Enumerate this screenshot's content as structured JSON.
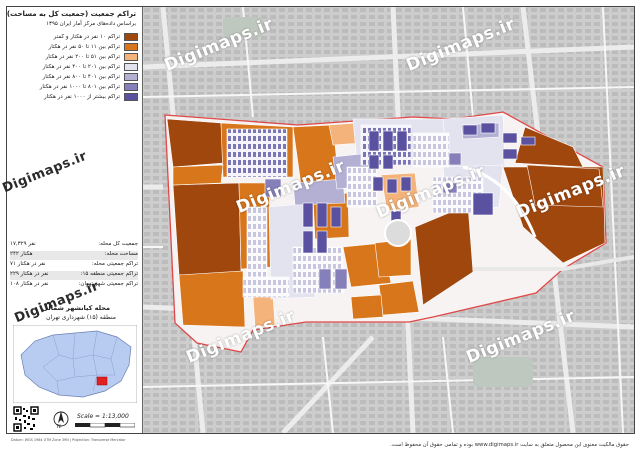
{
  "legend": {
    "title": "تراکم جمعیت (جمعیت کل به مساحت)",
    "subtitle": "براساس داده‌های مرکز آمار ایران ۱۳۹۵",
    "classes": [
      {
        "label": "تراکم ۱۰ نفر در هکتار و کمتر",
        "color": "#a0470e"
      },
      {
        "label": "تراکم بین ۱۱ تا ۵۰ نفر در هکتار",
        "color": "#d8761c"
      },
      {
        "label": "تراکم بین ۵۱ تا ۲۰۰ نفر در هکتار",
        "color": "#f3b37a"
      },
      {
        "label": "تراکم بین ۲۰۱ تا ۴۰۰ نفر در هکتار",
        "color": "#e3e2ef"
      },
      {
        "label": "تراکم بین ۴۰۱ تا ۸۰۰ نفر در هکتار",
        "color": "#b3b0d4"
      },
      {
        "label": "تراکم بین ۸۰۱ تا ۱۰۰۰ نفر در هکتار",
        "color": "#8580ba"
      },
      {
        "label": "تراکم بیشتر از ۱۰۰۰ نفر در هکتار",
        "color": "#5a52a1"
      }
    ]
  },
  "stats": [
    {
      "key": "جمعیت کل محله:",
      "value": "۱۷,۳۲۹ نفر"
    },
    {
      "key": "مساحت محله:",
      "value": "۲۴۲ هکتار"
    },
    {
      "key": "تراکم جمعیتی محله:",
      "value": "۷۱ نفر در هکتار"
    },
    {
      "key": "تراکم جمعیتی منطقه ۱۵:",
      "value": "۲۲۹ نفر در هکتار"
    },
    {
      "key": "تراکم جمعیتی شهر تهران:",
      "value": "۱۰۸ نفر در هکتار"
    }
  ],
  "locality": {
    "line1": "محله کیانشهر شمالی",
    "line2": "منطقه (۱۵) شهرداری تهران"
  },
  "scale": "Scale = 1:13,000",
  "north": "N",
  "credit": "Datum: WGS 1984 UTM Zone 39N | Projection: Transverse Mercator",
  "watermarks": [
    "Digimaps.ir",
    "Digimaps.ir",
    "Digimaps.ir",
    "Digimaps.ir",
    "Digimaps.ir",
    "Digimaps.ir",
    "Digimaps.ir",
    "Digimaps.ir",
    "Digimaps.ir"
  ],
  "footer": "حقوق مالکیت معنوی این محصول متعلق به سایت www.digimaps.ir بوده و تمامی حقوق آن محفوظ است."
}
